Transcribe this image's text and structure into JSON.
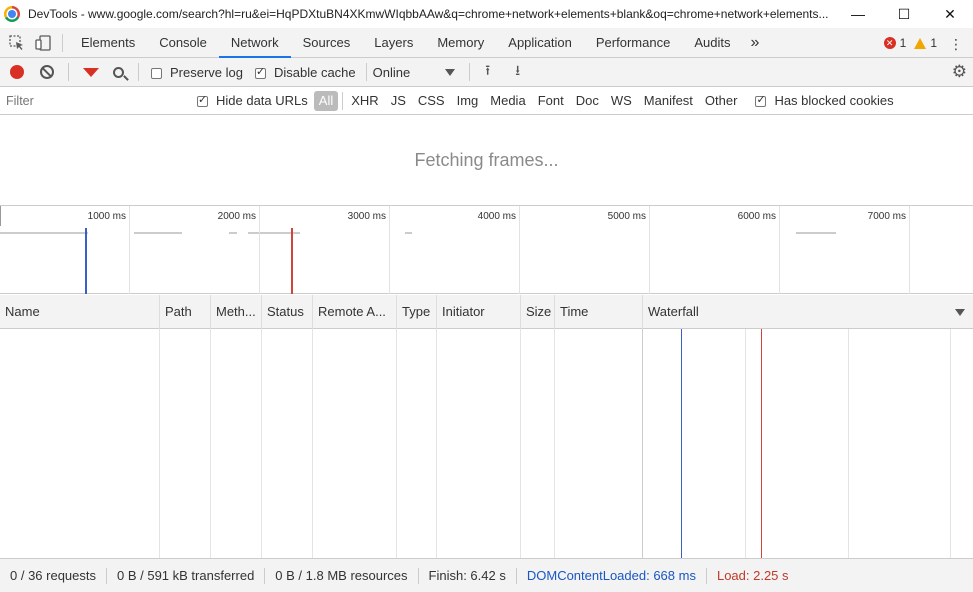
{
  "window": {
    "title": "DevTools - www.google.com/search?hl=ru&ei=HqPDXtuBN4XKmwWIqbbAAw&q=chrome+network+elements+blank&oq=chrome+network+elements...",
    "minimize": "—",
    "maximize": "☐",
    "close": "✕"
  },
  "tabs": {
    "items": [
      "Elements",
      "Console",
      "Network",
      "Sources",
      "Layers",
      "Memory",
      "Application",
      "Performance",
      "Audits"
    ],
    "active": "Network",
    "more": "»",
    "errors": "1",
    "warnings": "1",
    "menu": "⋮"
  },
  "toolbar": {
    "preserve_log": "Preserve log",
    "preserve_log_checked": false,
    "disable_cache": "Disable cache",
    "disable_cache_checked": true,
    "throttling": "Online",
    "import_glyph": "⭱",
    "export_glyph": "⭳",
    "settings_glyph": "⚙"
  },
  "filterbar": {
    "placeholder": "Filter",
    "hide_data_urls": "Hide data URLs",
    "types": [
      "All",
      "XHR",
      "JS",
      "CSS",
      "Img",
      "Media",
      "Font",
      "Doc",
      "WS",
      "Manifest",
      "Other"
    ],
    "active_type": "All",
    "blocked_cookies": "Has blocked cookies"
  },
  "frames_message": "Fetching frames...",
  "overview": {
    "ticks": [
      "1000 ms",
      "2000 ms",
      "3000 ms",
      "4000 ms",
      "5000 ms",
      "6000 ms",
      "7000 ms"
    ],
    "dom_content_loaded_color": "#3b5fc4",
    "load_color": "#d0453b"
  },
  "grid": {
    "columns": [
      "Name",
      "Path",
      "Meth...",
      "Status",
      "Remote A...",
      "Type",
      "Initiator",
      "Size",
      "Time",
      "Waterfall"
    ]
  },
  "status": {
    "requests": "0 / 36 requests",
    "transferred": "0 B / 591 kB transferred",
    "resources": "0 B / 1.8 MB resources",
    "finish": "Finish: 6.42 s",
    "dom_content_loaded": "DOMContentLoaded: 668 ms",
    "load": "Load: 2.25 s"
  }
}
